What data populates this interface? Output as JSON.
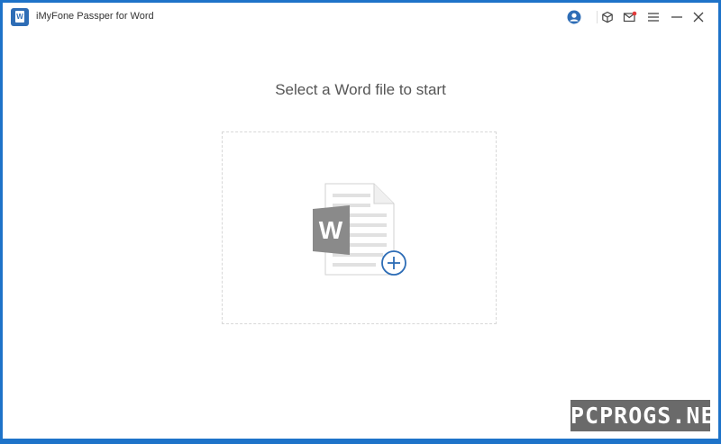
{
  "window": {
    "title": "iMyFone Passper for Word",
    "logo_letter": "W"
  },
  "titlebar": {
    "icons": [
      "account-icon",
      "cube-icon",
      "mail-icon",
      "menu-icon",
      "minimize-icon",
      "close-icon"
    ]
  },
  "main": {
    "heading": "Select a Word file to start",
    "word_icon_letter": "W"
  },
  "watermark": "PCPROGS.NET",
  "colors": {
    "accent": "#2e6db6",
    "word_gray": "#8a8a8a",
    "mail_badge": "#e23b3b",
    "desktop": "#1e73c9"
  }
}
